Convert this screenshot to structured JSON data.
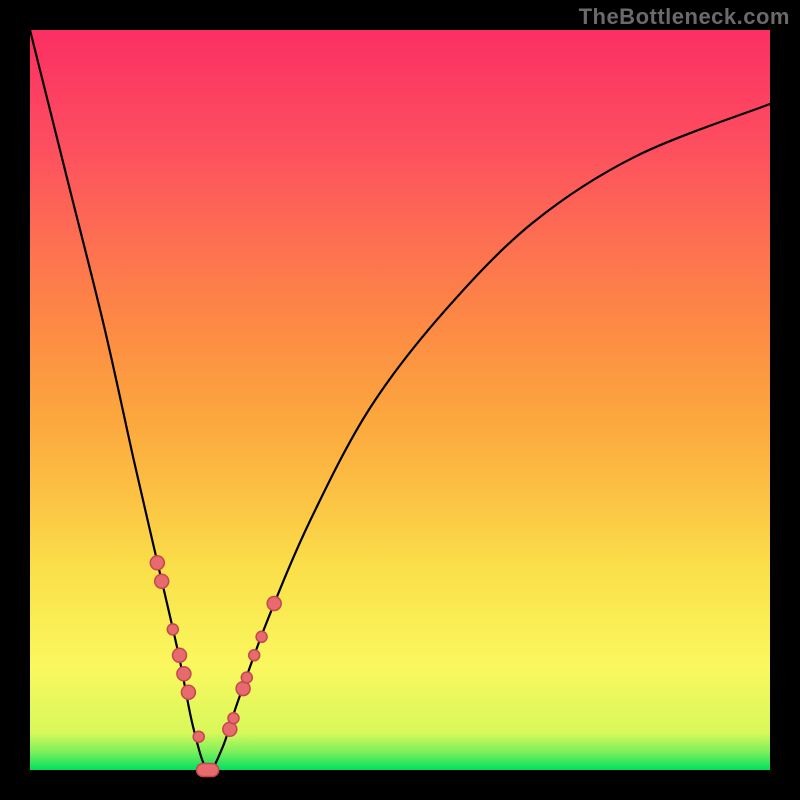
{
  "watermark": "TheBottleneck.com",
  "colors": {
    "frame": "#000000",
    "marker_fill": "#e66a6e",
    "marker_stroke": "#c2484c",
    "curve": "#000000"
  },
  "chart_data": {
    "type": "line",
    "title": "",
    "xlabel": "",
    "ylabel": "",
    "xlim": [
      0,
      100
    ],
    "ylim": [
      0,
      100
    ],
    "grid": false,
    "legend": false,
    "x_min": 24,
    "series": [
      {
        "name": "bottleneck-curve",
        "x": [
          0,
          5,
          10,
          14,
          17,
          20,
          22,
          24,
          26,
          28,
          32,
          38,
          46,
          56,
          68,
          82,
          100
        ],
        "y": [
          100,
          80,
          60,
          42,
          29,
          16,
          6,
          0,
          3,
          9,
          20,
          34,
          49,
          62,
          74,
          83,
          90
        ]
      }
    ],
    "markers": {
      "name": "highlight-points",
      "radius_small": 5.5,
      "radius_large": 7,
      "x": [
        17.2,
        17.8,
        19.3,
        20.2,
        20.8,
        21.4,
        22.8,
        27.0,
        27.5,
        28.8,
        29.3,
        30.3,
        31.3,
        33.0
      ],
      "y": [
        28,
        25.5,
        19,
        15.5,
        13,
        10.5,
        4.5,
        5.5,
        7,
        11,
        12.5,
        15.5,
        18,
        22.5
      ],
      "sizes": [
        "l",
        "l",
        "s",
        "l",
        "l",
        "l",
        "s",
        "l",
        "s",
        "l",
        "s",
        "s",
        "s",
        "l"
      ]
    },
    "min_band": {
      "x_start": 22.5,
      "x_end": 25.5,
      "y": 0
    }
  }
}
